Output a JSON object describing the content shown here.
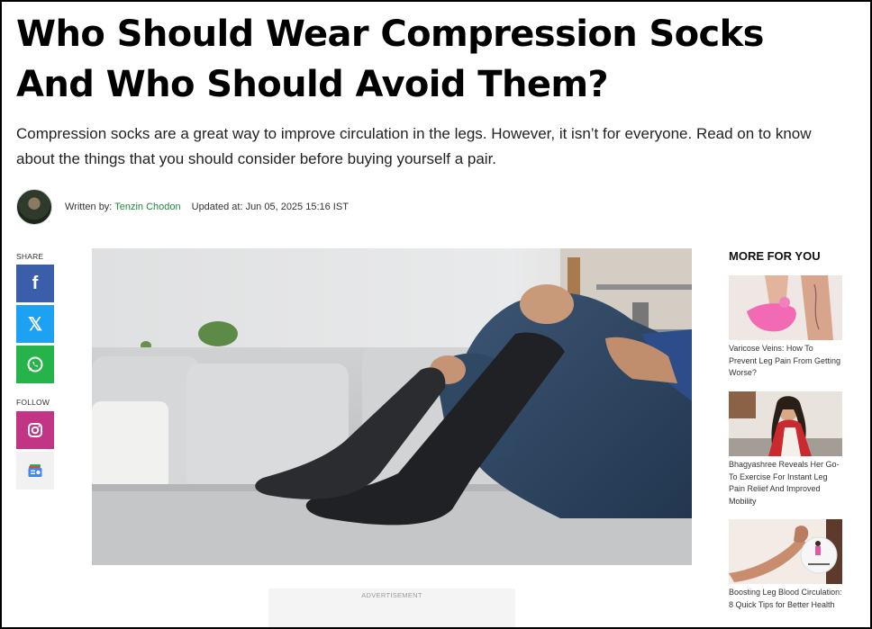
{
  "article": {
    "title": "Who Should Wear Compression Socks And Who Should Avoid Them?",
    "subtitle": "Compression socks are a great way to improve circulation in the legs. However, it isn’t for everyone. Read on to know about the things that you should consider before buying yourself a pair.",
    "written_by_label": "Written by:",
    "author": "Tenzin Chodon",
    "updated_label": "Updated at:",
    "updated_at": "Jun 05, 2025 15:16 IST"
  },
  "share": {
    "label": "SHARE",
    "follow_label": "FOLLOW",
    "buttons": [
      "facebook-icon",
      "x-icon",
      "whatsapp-icon"
    ],
    "follow_buttons": [
      "instagram-icon",
      "google-news-icon"
    ]
  },
  "hero": {
    "icon": "compression-socks-photo"
  },
  "ad": {
    "label": "ADVERTISEMENT"
  },
  "more_for_you": {
    "title": "MORE FOR YOU",
    "items": [
      {
        "text": "Varicose Veins: How To Prevent Leg Pain From Getting Worse?"
      },
      {
        "text": "Bhagyashree Reveals Her Go-To Exercise For Instant Leg Pain Relief And Improved Mobility"
      },
      {
        "text": "Boosting Leg Blood Circulation: 8 Quick Tips for Better Health"
      }
    ]
  },
  "colors": {
    "facebook": "#3b5eab",
    "x": "#1da1f2",
    "whatsapp": "#25b34a",
    "instagram": "#c13584",
    "author_link": "#1d8a3e"
  }
}
